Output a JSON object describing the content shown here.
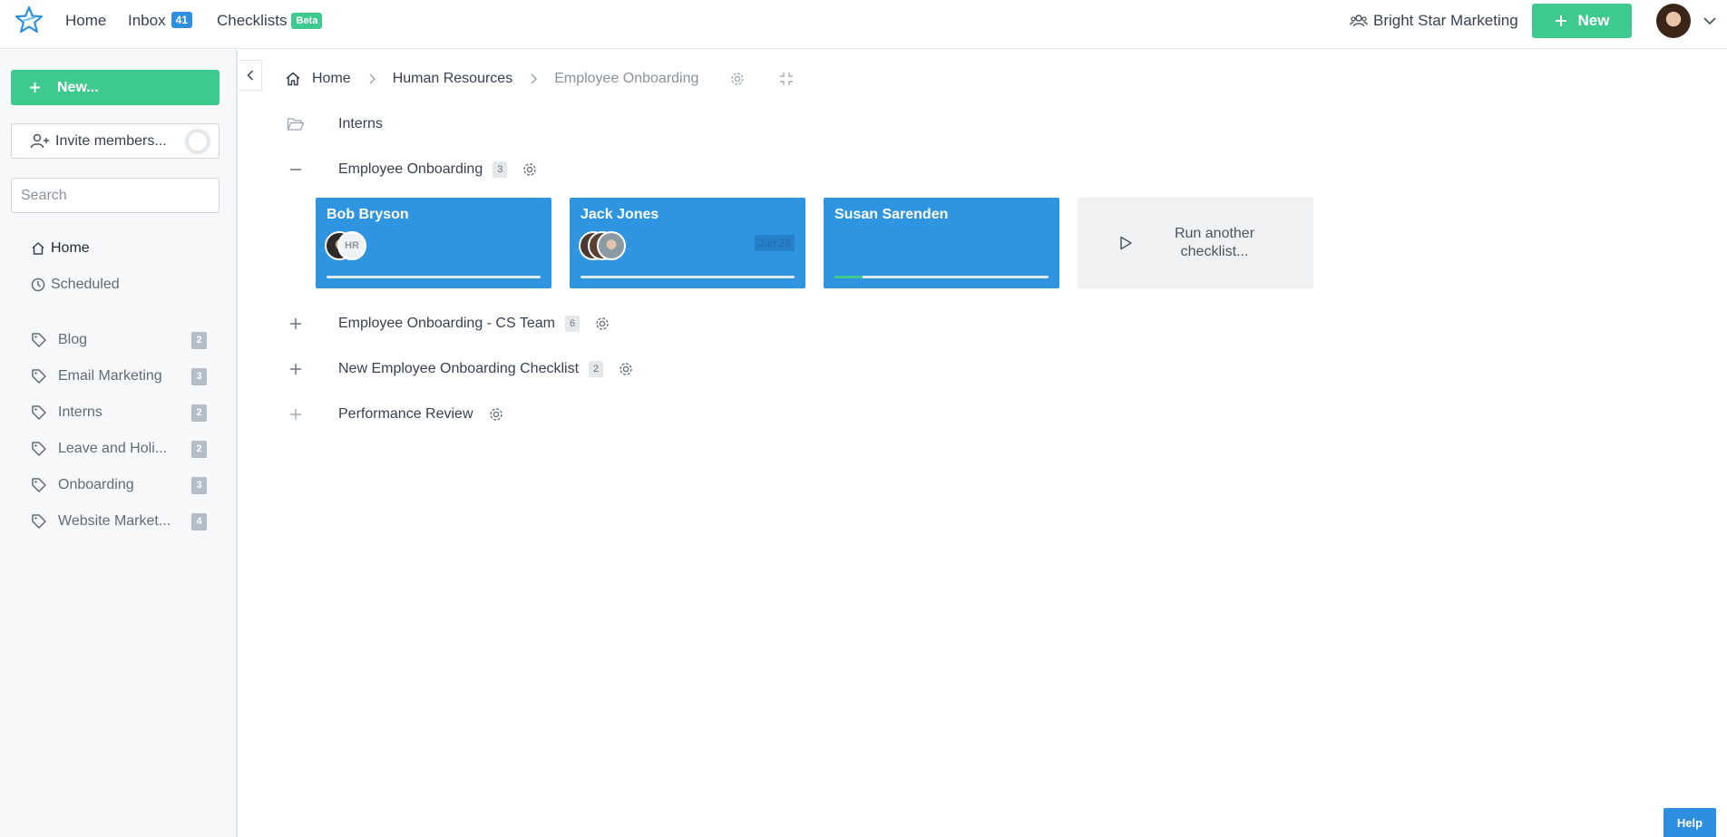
{
  "topbar": {
    "home_label": "Home",
    "inbox_label": "Inbox",
    "inbox_count": "41",
    "checklists_label": "Checklists",
    "checklists_badge": "Beta",
    "org_name": "Bright Star Marketing",
    "new_button_label": "New"
  },
  "sidebar": {
    "new_button_label": "New...",
    "invite_button_label": "Invite members...",
    "search_placeholder": "Search",
    "nav": [
      {
        "label": "Home",
        "icon": "home-icon"
      },
      {
        "label": "Scheduled",
        "icon": "clock-icon"
      }
    ],
    "tags": [
      {
        "label": "Blog",
        "count": "2"
      },
      {
        "label": "Email Marketing",
        "count": "3"
      },
      {
        "label": "Interns",
        "count": "2"
      },
      {
        "label": "Leave and Holi...",
        "count": "2"
      },
      {
        "label": "Onboarding",
        "count": "3"
      },
      {
        "label": "Website Market...",
        "count": "4"
      }
    ]
  },
  "breadcrumb": {
    "items": [
      "Home",
      "Human Resources",
      "Employee Onboarding"
    ]
  },
  "folders": [
    {
      "label": "Interns",
      "icon": "folder-open-icon"
    }
  ],
  "templates": [
    {
      "label": "Employee Onboarding",
      "count": "3",
      "state": "expanded"
    },
    {
      "label": "Employee Onboarding - CS Team",
      "count": "6",
      "state": "collapsed"
    },
    {
      "label": "New Employee Onboarding Checklist",
      "count": "2",
      "state": "collapsed"
    },
    {
      "label": "Performance Review",
      "count": "",
      "state": "collapsed"
    }
  ],
  "checklists": [
    {
      "name": "Bob Bryson",
      "assignees": [
        "photo",
        "HR"
      ],
      "due": "",
      "progress": 0
    },
    {
      "name": "Jack Jones",
      "assignees": [
        "photo",
        "photo",
        "photo"
      ],
      "due": "Jun 29",
      "progress": 0
    },
    {
      "name": "Susan Sarenden",
      "assignees": [],
      "due": "",
      "progress": 0.13
    }
  ],
  "run_another_label": "Run another checklist...",
  "help_label": "Help",
  "colors": {
    "accent_green": "#3ec98e",
    "card_blue": "#2f95e0",
    "badge_blue": "#2e8ee0"
  }
}
